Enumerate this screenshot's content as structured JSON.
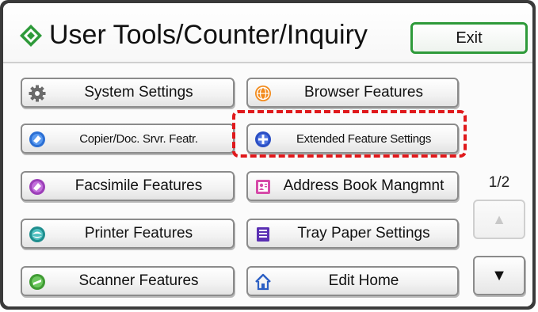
{
  "header": {
    "title": "User Tools/Counter/Inquiry",
    "exit_label": "Exit"
  },
  "left_column": [
    {
      "label": "System Settings",
      "icon": "gear-icon"
    },
    {
      "label": "Copier/Doc. Srvr. Featr.",
      "icon": "copier-icon"
    },
    {
      "label": "Facsimile Features",
      "icon": "facsimile-icon"
    },
    {
      "label": "Printer Features",
      "icon": "printer-icon"
    },
    {
      "label": "Scanner Features",
      "icon": "scanner-icon"
    }
  ],
  "right_column": [
    {
      "label": "Browser Features",
      "icon": "browser-icon"
    },
    {
      "label": "Extended Feature Settings",
      "icon": "extended-feature-icon"
    },
    {
      "label": "Address Book Mangmnt",
      "icon": "address-book-icon"
    },
    {
      "label": "Tray Paper Settings",
      "icon": "tray-paper-icon"
    },
    {
      "label": "Edit Home",
      "icon": "home-icon"
    }
  ],
  "pagination": {
    "indicator": "1/2",
    "up_symbol": "▲",
    "down_symbol": "▼"
  },
  "colors": {
    "exit_border": "#2e9a3a",
    "highlight": "#e0191c",
    "frame": "#3a3a3a"
  }
}
